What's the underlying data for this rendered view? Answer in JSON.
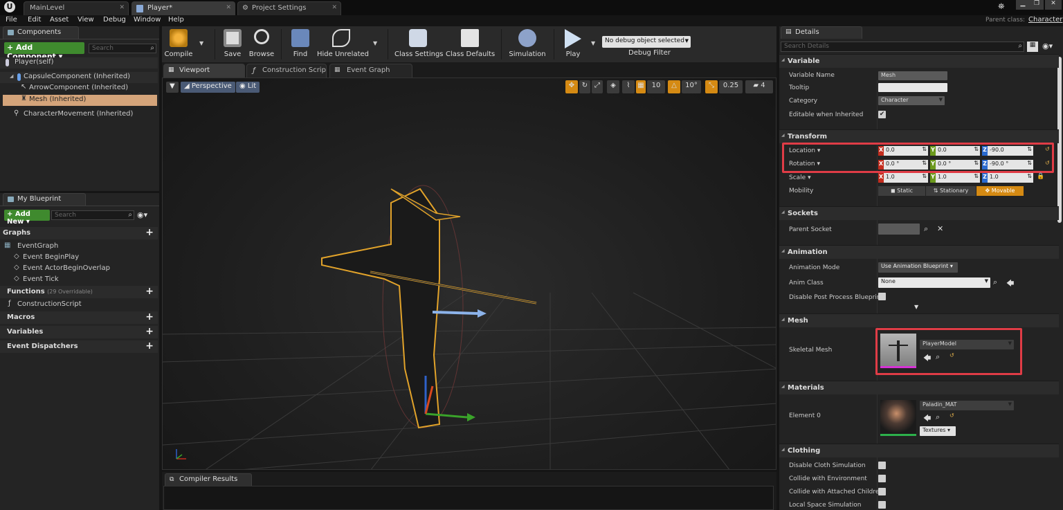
{
  "tabs": [
    {
      "label": "MainLevel"
    },
    {
      "label": "Player*"
    },
    {
      "label": "Project Settings"
    }
  ],
  "menu": [
    "File",
    "Edit",
    "Asset",
    "View",
    "Debug",
    "Window",
    "Help"
  ],
  "parent_class": {
    "label": "Parent class:",
    "value": "Character"
  },
  "components": {
    "title": "Components",
    "add_label": "+ Add Component ▾",
    "search_placeholder": "Search",
    "items": [
      "Player(self)",
      "CapsuleComponent (Inherited)",
      "ArrowComponent (Inherited)",
      "Mesh (Inherited)",
      "CharacterMovement (Inherited)"
    ]
  },
  "my_blueprint": {
    "title": "My Blueprint",
    "add_label": "+ Add New ▾",
    "search_placeholder": "Search",
    "graphs_label": "Graphs",
    "graph_items": [
      "EventGraph",
      "Event BeginPlay",
      "Event ActorBeginOverlap",
      "Event Tick"
    ],
    "functions_label": "Functions",
    "functions_note": "(29 Overridable)",
    "function_items": [
      "ConstructionScript"
    ],
    "macros_label": "Macros",
    "variables_label": "Variables",
    "dispatchers_label": "Event Dispatchers"
  },
  "toolbar": {
    "compile": "Compile",
    "save": "Save",
    "browse": "Browse",
    "find": "Find",
    "hide_unrelated": "Hide Unrelated",
    "class_settings": "Class Settings",
    "class_defaults": "Class Defaults",
    "simulation": "Simulation",
    "play": "Play",
    "debug_select": "No debug object selected",
    "debug_filter": "Debug Filter"
  },
  "editor_tabs": [
    "Viewport",
    "Construction Scrip",
    "Event Graph"
  ],
  "viewport": {
    "perspective": "Perspective",
    "lit": "Lit",
    "grid_snap": "10",
    "rot_snap": "10°",
    "scale_snap": "0.25",
    "cam_speed": "4"
  },
  "compiler_results": "Compiler Results",
  "details": {
    "title": "Details",
    "search_placeholder": "Search Details",
    "variable": {
      "section": "Variable",
      "name_label": "Variable Name",
      "name_value": "Mesh",
      "tooltip_label": "Tooltip",
      "tooltip_value": "",
      "category_label": "Category",
      "category_value": "Character",
      "editable_label": "Editable when Inherited",
      "editable_checked": "✔"
    },
    "transform": {
      "section": "Transform",
      "location_label": "Location ▾",
      "rotation_label": "Rotation ▾",
      "scale_label": "Scale ▾",
      "mobility_label": "Mobility",
      "location": {
        "x": "0.0",
        "y": "0.0",
        "z": "-90.0"
      },
      "rotation": {
        "x": "0.0 °",
        "y": "0.0 °",
        "z": "-90.0 °"
      },
      "scale": {
        "x": "1.0",
        "y": "1.0",
        "z": "1.0"
      },
      "mobility_options": [
        "Static",
        "Stationary",
        "Movable"
      ],
      "mobility_selected": "Movable"
    },
    "sockets": {
      "section": "Sockets",
      "parent_label": "Parent Socket"
    },
    "animation": {
      "section": "Animation",
      "mode_label": "Animation Mode",
      "mode_value": "Use Animation Blueprint ▾",
      "class_label": "Anim Class",
      "class_value": "None",
      "disable_pp_label": "Disable Post Process Blueprint"
    },
    "mesh": {
      "section": "Mesh",
      "skeletal_label": "Skeletal Mesh",
      "skeletal_value": "PlayerModel"
    },
    "materials": {
      "section": "Materials",
      "element_label": "Element 0",
      "element_value": "Paladin_MAT",
      "textures": "Textures ▾"
    },
    "clothing": {
      "section": "Clothing",
      "items": [
        "Disable Cloth Simulation",
        "Collide with Environment",
        "Collide with Attached Children",
        "Local Space Simulation"
      ]
    }
  },
  "colors": {
    "highlight_red": "#e03c46",
    "selected_row": "#d4a47a",
    "orange_accent": "#d58a13"
  }
}
